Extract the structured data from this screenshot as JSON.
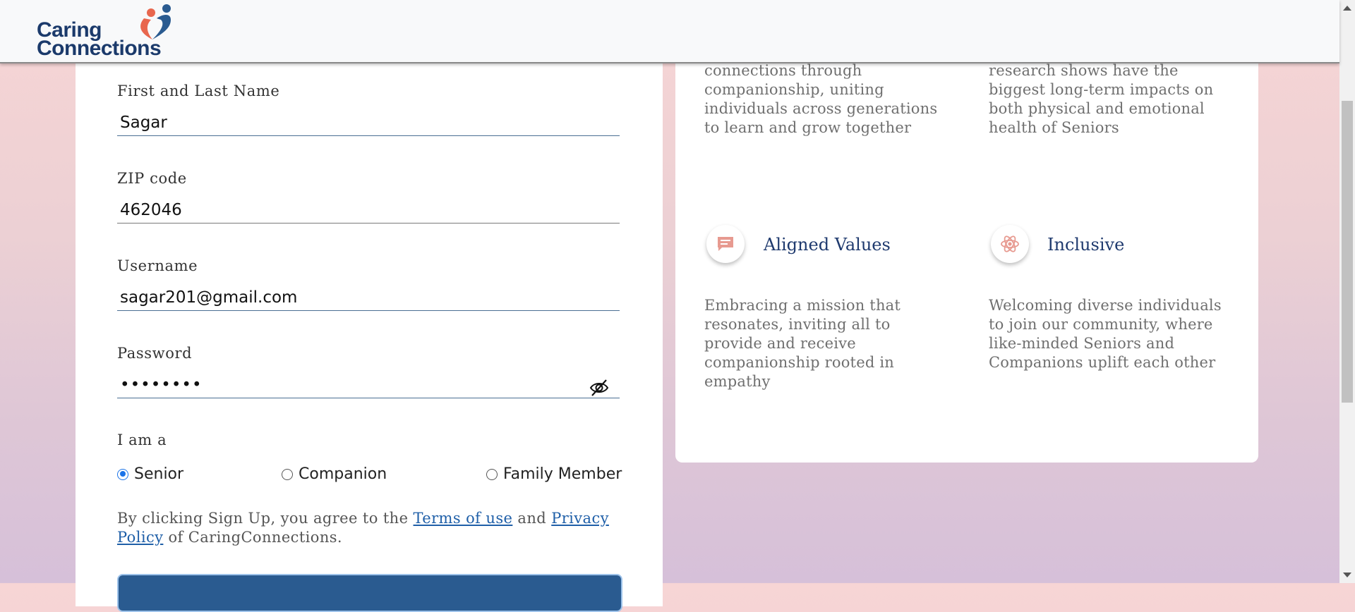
{
  "header": {
    "logo_line1": "Caring",
    "logo_line2": "Connections",
    "brand_colors": {
      "navy": "#1b3a6b",
      "heart_red": "#e8674e",
      "heart_blue": "#2a5b90"
    }
  },
  "form": {
    "name": {
      "label": "First and Last Name",
      "value": "Sagar"
    },
    "zip": {
      "label": "ZIP code",
      "value": "462046"
    },
    "username": {
      "label": "Username",
      "value": "sagar201@gmail.com"
    },
    "password": {
      "label": "Password",
      "value": "••••••••",
      "toggle_icon": "eye-slash-icon"
    },
    "role": {
      "label": "I am a",
      "options": [
        "Senior",
        "Companion",
        "Family Member"
      ],
      "selected": "Senior"
    },
    "consent": {
      "prefix": "By clicking Sign Up, you agree to the ",
      "terms_link": "Terms of use",
      "middle": " and ",
      "privacy_link": "Privacy Policy",
      "suffix": " of CaringConnections."
    },
    "signup_color": "#2a5b90"
  },
  "info": {
    "top_left_desc": "connections through companionship, uniting individuals across generations to learn and grow together",
    "top_right_desc": "research shows have the biggest long-term impacts on both physical and emotional health of Seniors",
    "features": [
      {
        "icon": "chat-icon",
        "title": "Aligned Values",
        "desc": "Embracing a mission that resonates, inviting all to provide and receive companionship rooted in empathy"
      },
      {
        "icon": "atom-icon",
        "title": "Inclusive",
        "desc": "Welcoming diverse individuals to join our community, where like-minded Seniors and Companions uplift each other"
      }
    ],
    "icon_color": "#e79a90",
    "title_color": "#1f3a6e"
  }
}
